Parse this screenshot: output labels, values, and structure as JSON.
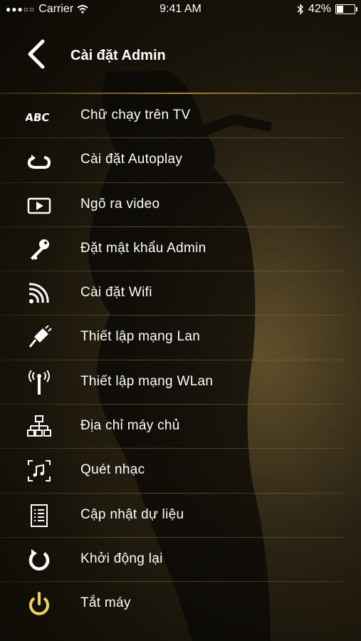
{
  "status_bar": {
    "carrier": "Carrier",
    "time": "9:41 AM",
    "battery_percent": "42%",
    "battery_level": 0.42
  },
  "header": {
    "title": "Cài đặt Admin",
    "back_icon": "chevron-left-icon"
  },
  "accent_color": "#f3d24f",
  "menu": {
    "items": [
      {
        "label": "Chữ chạy trên TV",
        "icon": "abc-text-icon"
      },
      {
        "label": "Cài đặt Autoplay",
        "icon": "autoplay-loop-icon"
      },
      {
        "label": "Ngõ ra video",
        "icon": "video-output-icon"
      },
      {
        "label": "Đặt mật khẩu Admin",
        "icon": "key-icon"
      },
      {
        "label": "Cài đặt Wifi",
        "icon": "wifi-icon"
      },
      {
        "label": "Thiết lập mạng Lan",
        "icon": "lan-cable-icon"
      },
      {
        "label": "Thiết lập mạng WLan",
        "icon": "antenna-icon"
      },
      {
        "label": "Địa chỉ máy chủ",
        "icon": "server-network-icon"
      },
      {
        "label": "Quét nhạc",
        "icon": "music-scan-icon"
      },
      {
        "label": "Cập nhật dự liệu",
        "icon": "document-list-icon"
      },
      {
        "label": "Khởi động lại",
        "icon": "restart-icon"
      },
      {
        "label": "Tắt máy",
        "icon": "power-icon"
      }
    ]
  }
}
